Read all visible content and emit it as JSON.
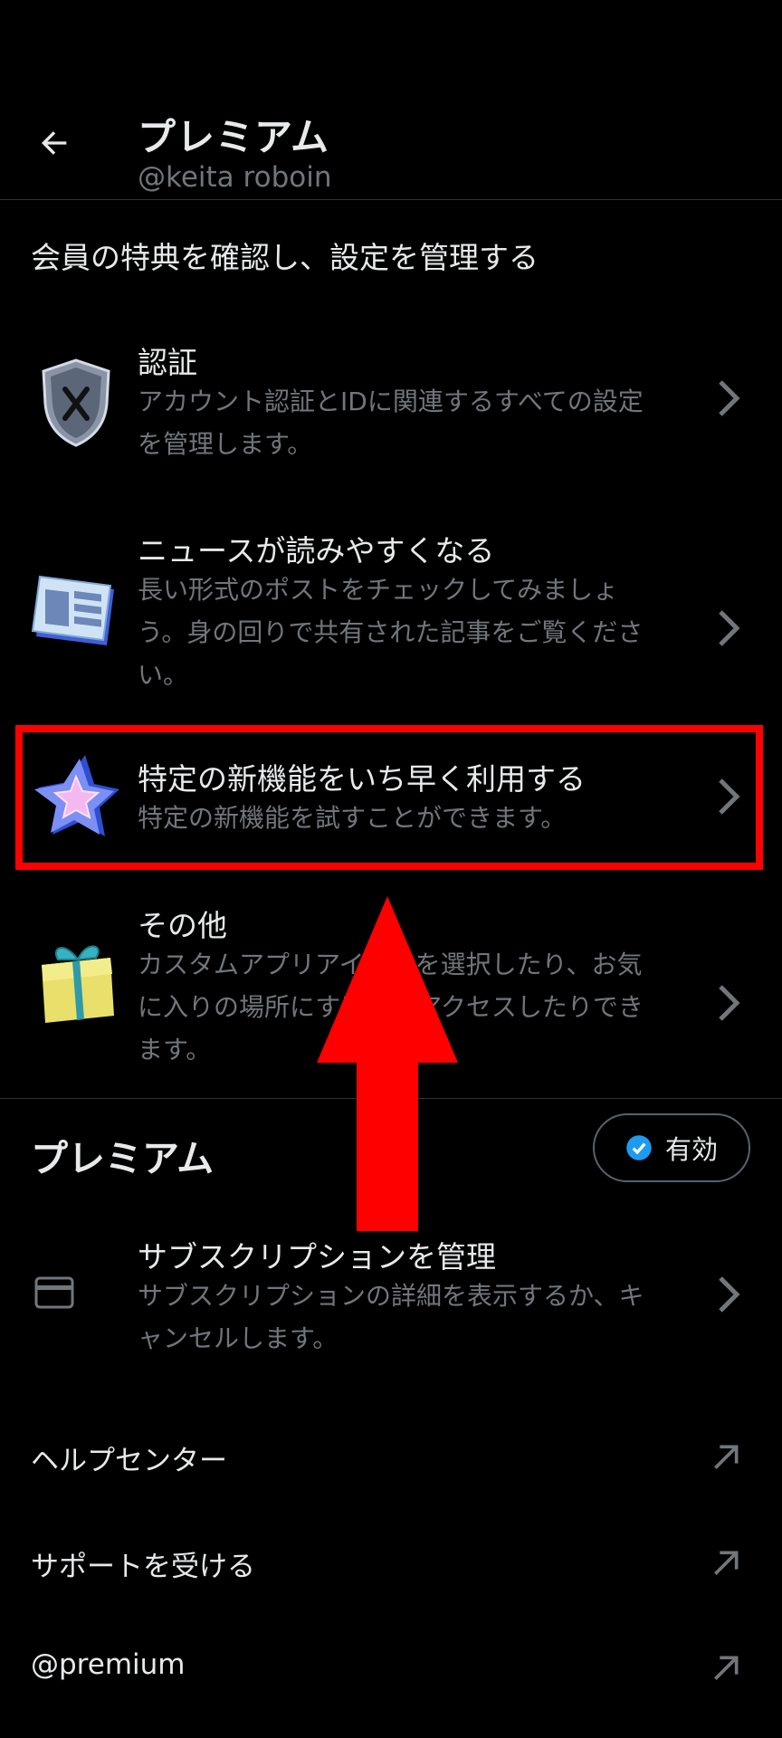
{
  "header": {
    "title": "プレミアム",
    "handle": "@keita roboin"
  },
  "section_description": "会員の特典を確認し、設定を管理する",
  "features": [
    {
      "title": "認証",
      "desc_line1": "アカウント認証とIDに関連するすべての設定",
      "desc_line2": "を管理します。",
      "icon": "shield-x-icon"
    },
    {
      "title": "ニュースが読みやすくなる",
      "desc_line1": "長い形式のポストをチェックしてみましょ",
      "desc_line2": "う。身の回りで共有された記事をご覧くださ",
      "desc_line3": "い。",
      "icon": "newspaper-icon"
    },
    {
      "title": "特定の新機能をいち早く利用する",
      "desc_line1": "特定の新機能を試すことができます。",
      "icon": "star-icon"
    },
    {
      "title": "その他",
      "desc_line1": "カスタムアプリアイコンを選択したり、お気",
      "desc_line2": "に入りの場所にすばやくアクセスしたりでき",
      "desc_line3": "ます。",
      "icon": "gift-icon"
    }
  ],
  "premium": {
    "title": "プレミアム",
    "status": "有効",
    "subscription": {
      "title": "サブスクリプションを管理",
      "desc_line1": "サブスクリプションの詳細を表示するか、キ",
      "desc_line2": "ャンセルします。",
      "icon": "credit-card-icon"
    }
  },
  "links": [
    {
      "label": "ヘルプセンター"
    },
    {
      "label": "サポートを受ける"
    },
    {
      "label": "@premium"
    }
  ],
  "colors": {
    "background": "#000000",
    "primary_text": "#e7e9ea",
    "secondary_text": "#71767b",
    "divider": "#2f3336",
    "highlight": "#ff0000",
    "verified_blue": "#1d9bf0"
  }
}
